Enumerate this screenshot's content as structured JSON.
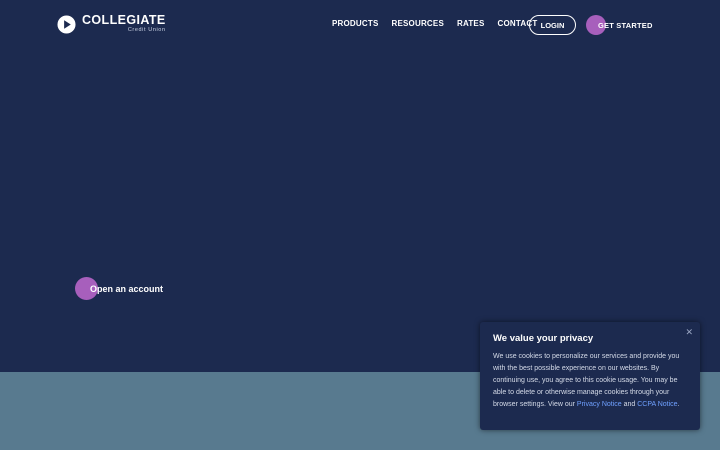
{
  "brand": {
    "name": "COLLEGIATE",
    "subtitle": "Credit Union",
    "logo_icon": "play-triangle-logo-icon"
  },
  "nav": {
    "items": [
      {
        "label": "PRODUCTS"
      },
      {
        "label": "RESOURCES"
      },
      {
        "label": "RATES"
      },
      {
        "label": "CONTACT"
      }
    ]
  },
  "header_actions": {
    "login_label": "LOGIN",
    "get_started_label": "GET STARTED"
  },
  "hero": {
    "cta_label": "Open an account"
  },
  "cookie_banner": {
    "title": "We value your privacy",
    "body_text": "We use cookies to personalize our services and provide you with the best possible experience on our websites. By continuing use, you agree to this cookie usage. You may be able to delete or otherwise manage cookies through your browser settings. View our",
    "privacy_link": "Privacy Notice",
    "and_text": "and",
    "ccpa_link": "CCPA Notice",
    "end_punct": ".",
    "close_icon": "close-icon"
  },
  "colors": {
    "background": "#1c2a4f",
    "accent_dot": "#a75fbc",
    "lower_band": "#587a8f",
    "link": "#6fa0ff"
  }
}
